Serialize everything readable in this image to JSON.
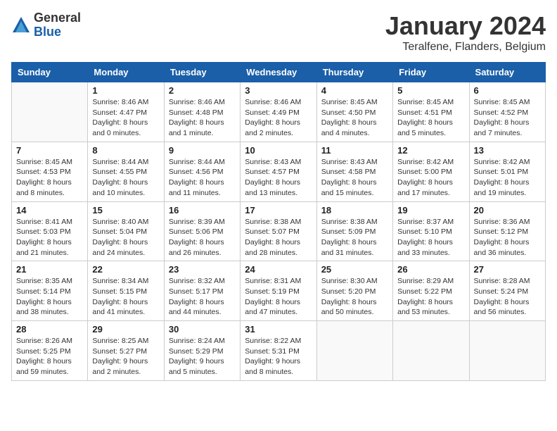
{
  "logo": {
    "general": "General",
    "blue": "Blue"
  },
  "header": {
    "month": "January 2024",
    "location": "Teralfene, Flanders, Belgium"
  },
  "days_of_week": [
    "Sunday",
    "Monday",
    "Tuesday",
    "Wednesday",
    "Thursday",
    "Friday",
    "Saturday"
  ],
  "weeks": [
    [
      {
        "day": "",
        "sunrise": "",
        "sunset": "",
        "daylight": ""
      },
      {
        "day": "1",
        "sunrise": "Sunrise: 8:46 AM",
        "sunset": "Sunset: 4:47 PM",
        "daylight": "Daylight: 8 hours and 0 minutes."
      },
      {
        "day": "2",
        "sunrise": "Sunrise: 8:46 AM",
        "sunset": "Sunset: 4:48 PM",
        "daylight": "Daylight: 8 hours and 1 minute."
      },
      {
        "day": "3",
        "sunrise": "Sunrise: 8:46 AM",
        "sunset": "Sunset: 4:49 PM",
        "daylight": "Daylight: 8 hours and 2 minutes."
      },
      {
        "day": "4",
        "sunrise": "Sunrise: 8:45 AM",
        "sunset": "Sunset: 4:50 PM",
        "daylight": "Daylight: 8 hours and 4 minutes."
      },
      {
        "day": "5",
        "sunrise": "Sunrise: 8:45 AM",
        "sunset": "Sunset: 4:51 PM",
        "daylight": "Daylight: 8 hours and 5 minutes."
      },
      {
        "day": "6",
        "sunrise": "Sunrise: 8:45 AM",
        "sunset": "Sunset: 4:52 PM",
        "daylight": "Daylight: 8 hours and 7 minutes."
      }
    ],
    [
      {
        "day": "7",
        "sunrise": "Sunrise: 8:45 AM",
        "sunset": "Sunset: 4:53 PM",
        "daylight": "Daylight: 8 hours and 8 minutes."
      },
      {
        "day": "8",
        "sunrise": "Sunrise: 8:44 AM",
        "sunset": "Sunset: 4:55 PM",
        "daylight": "Daylight: 8 hours and 10 minutes."
      },
      {
        "day": "9",
        "sunrise": "Sunrise: 8:44 AM",
        "sunset": "Sunset: 4:56 PM",
        "daylight": "Daylight: 8 hours and 11 minutes."
      },
      {
        "day": "10",
        "sunrise": "Sunrise: 8:43 AM",
        "sunset": "Sunset: 4:57 PM",
        "daylight": "Daylight: 8 hours and 13 minutes."
      },
      {
        "day": "11",
        "sunrise": "Sunrise: 8:43 AM",
        "sunset": "Sunset: 4:58 PM",
        "daylight": "Daylight: 8 hours and 15 minutes."
      },
      {
        "day": "12",
        "sunrise": "Sunrise: 8:42 AM",
        "sunset": "Sunset: 5:00 PM",
        "daylight": "Daylight: 8 hours and 17 minutes."
      },
      {
        "day": "13",
        "sunrise": "Sunrise: 8:42 AM",
        "sunset": "Sunset: 5:01 PM",
        "daylight": "Daylight: 8 hours and 19 minutes."
      }
    ],
    [
      {
        "day": "14",
        "sunrise": "Sunrise: 8:41 AM",
        "sunset": "Sunset: 5:03 PM",
        "daylight": "Daylight: 8 hours and 21 minutes."
      },
      {
        "day": "15",
        "sunrise": "Sunrise: 8:40 AM",
        "sunset": "Sunset: 5:04 PM",
        "daylight": "Daylight: 8 hours and 24 minutes."
      },
      {
        "day": "16",
        "sunrise": "Sunrise: 8:39 AM",
        "sunset": "Sunset: 5:06 PM",
        "daylight": "Daylight: 8 hours and 26 minutes."
      },
      {
        "day": "17",
        "sunrise": "Sunrise: 8:38 AM",
        "sunset": "Sunset: 5:07 PM",
        "daylight": "Daylight: 8 hours and 28 minutes."
      },
      {
        "day": "18",
        "sunrise": "Sunrise: 8:38 AM",
        "sunset": "Sunset: 5:09 PM",
        "daylight": "Daylight: 8 hours and 31 minutes."
      },
      {
        "day": "19",
        "sunrise": "Sunrise: 8:37 AM",
        "sunset": "Sunset: 5:10 PM",
        "daylight": "Daylight: 8 hours and 33 minutes."
      },
      {
        "day": "20",
        "sunrise": "Sunrise: 8:36 AM",
        "sunset": "Sunset: 5:12 PM",
        "daylight": "Daylight: 8 hours and 36 minutes."
      }
    ],
    [
      {
        "day": "21",
        "sunrise": "Sunrise: 8:35 AM",
        "sunset": "Sunset: 5:14 PM",
        "daylight": "Daylight: 8 hours and 38 minutes."
      },
      {
        "day": "22",
        "sunrise": "Sunrise: 8:34 AM",
        "sunset": "Sunset: 5:15 PM",
        "daylight": "Daylight: 8 hours and 41 minutes."
      },
      {
        "day": "23",
        "sunrise": "Sunrise: 8:32 AM",
        "sunset": "Sunset: 5:17 PM",
        "daylight": "Daylight: 8 hours and 44 minutes."
      },
      {
        "day": "24",
        "sunrise": "Sunrise: 8:31 AM",
        "sunset": "Sunset: 5:19 PM",
        "daylight": "Daylight: 8 hours and 47 minutes."
      },
      {
        "day": "25",
        "sunrise": "Sunrise: 8:30 AM",
        "sunset": "Sunset: 5:20 PM",
        "daylight": "Daylight: 8 hours and 50 minutes."
      },
      {
        "day": "26",
        "sunrise": "Sunrise: 8:29 AM",
        "sunset": "Sunset: 5:22 PM",
        "daylight": "Daylight: 8 hours and 53 minutes."
      },
      {
        "day": "27",
        "sunrise": "Sunrise: 8:28 AM",
        "sunset": "Sunset: 5:24 PM",
        "daylight": "Daylight: 8 hours and 56 minutes."
      }
    ],
    [
      {
        "day": "28",
        "sunrise": "Sunrise: 8:26 AM",
        "sunset": "Sunset: 5:25 PM",
        "daylight": "Daylight: 8 hours and 59 minutes."
      },
      {
        "day": "29",
        "sunrise": "Sunrise: 8:25 AM",
        "sunset": "Sunset: 5:27 PM",
        "daylight": "Daylight: 9 hours and 2 minutes."
      },
      {
        "day": "30",
        "sunrise": "Sunrise: 8:24 AM",
        "sunset": "Sunset: 5:29 PM",
        "daylight": "Daylight: 9 hours and 5 minutes."
      },
      {
        "day": "31",
        "sunrise": "Sunrise: 8:22 AM",
        "sunset": "Sunset: 5:31 PM",
        "daylight": "Daylight: 9 hours and 8 minutes."
      },
      {
        "day": "",
        "sunrise": "",
        "sunset": "",
        "daylight": ""
      },
      {
        "day": "",
        "sunrise": "",
        "sunset": "",
        "daylight": ""
      },
      {
        "day": "",
        "sunrise": "",
        "sunset": "",
        "daylight": ""
      }
    ]
  ]
}
